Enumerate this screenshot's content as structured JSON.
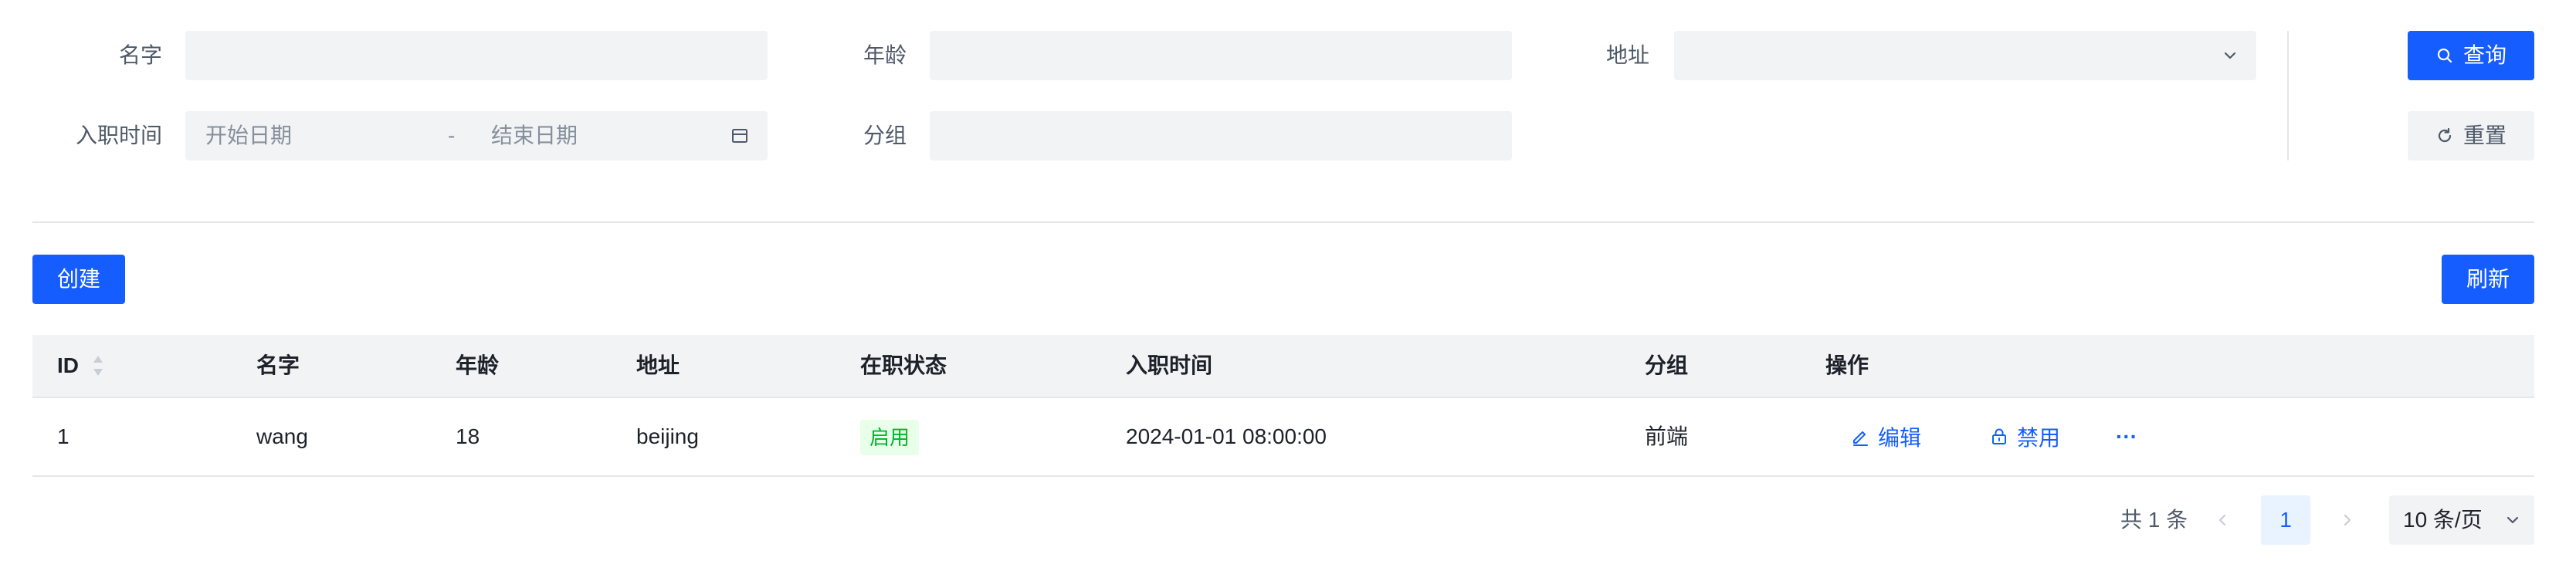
{
  "filters": {
    "name_label": "名字",
    "age_label": "年龄",
    "address_label": "地址",
    "hire_time_label": "入职时间",
    "start_date_placeholder": "开始日期",
    "date_separator": "-",
    "end_date_placeholder": "结束日期",
    "group_label": "分组",
    "query_label": "查询",
    "reset_label": "重置"
  },
  "toolbar": {
    "create_label": "创建",
    "refresh_label": "刷新"
  },
  "table": {
    "columns": [
      "ID",
      "名字",
      "年龄",
      "地址",
      "在职状态",
      "入职时间",
      "分组",
      "操作"
    ],
    "rows": [
      {
        "id": "1",
        "name": "wang",
        "age": "18",
        "address": "beijing",
        "status": "启用",
        "hire_time": "2024-01-01 08:00:00",
        "group": "前端",
        "edit_label": "编辑",
        "disable_label": "禁用",
        "more_label": "···"
      }
    ]
  },
  "pagination": {
    "total_text": "共 1 条",
    "current_page": "1",
    "page_size_label": "10 条/页"
  },
  "colors": {
    "primary": "#165dff",
    "status_green": "#00b42a",
    "status_green_bg": "#e8ffea"
  }
}
